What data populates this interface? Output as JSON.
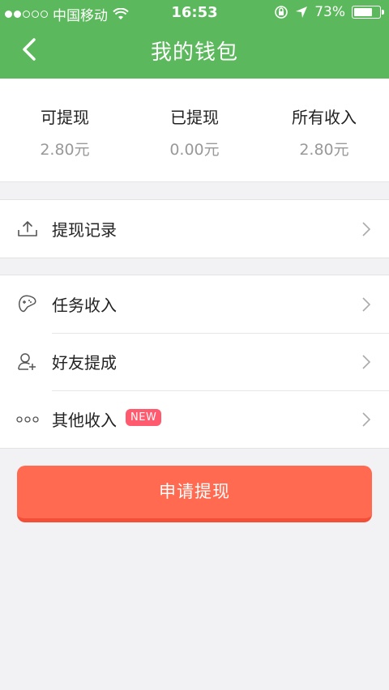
{
  "status_bar": {
    "carrier": "中国移动",
    "time": "16:53",
    "battery": "73%",
    "battery_level": 0.73
  },
  "header": {
    "title": "我的钱包"
  },
  "balance": [
    {
      "label": "可提现",
      "value": "2.80元"
    },
    {
      "label": "已提现",
      "value": "0.00元"
    },
    {
      "label": "所有收入",
      "value": "2.80元"
    }
  ],
  "records": {
    "withdraw_records": "提现记录"
  },
  "income": {
    "task_income": "任务收入",
    "friend_commission": "好友提成",
    "other_income": "其他收入",
    "new_badge": "NEW"
  },
  "actions": {
    "apply_withdraw": "申请提现"
  },
  "colors": {
    "header_green": "#5cb85c",
    "button_orange": "#ff6a50",
    "badge_red": "#ff5a6e"
  }
}
